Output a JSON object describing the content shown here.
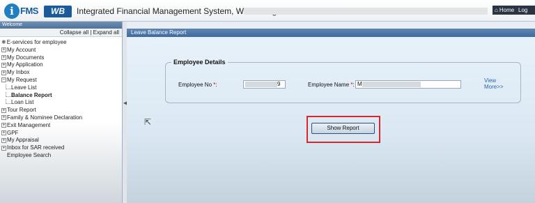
{
  "header": {
    "logo_letter": "i",
    "logo_text": "FMS",
    "logo_region": "WB",
    "app_title": "Integrated Financial Management System, West Bengal",
    "home_label": "Home",
    "logout_label": "Log"
  },
  "sidebar": {
    "welcome": "Welcome",
    "collapse_all": "Collapse all",
    "separator": "|",
    "expand_all": "Expand all",
    "root": "E-services for employee",
    "items": [
      {
        "label": "My Account",
        "type": "plus"
      },
      {
        "label": "My Documents",
        "type": "plus"
      },
      {
        "label": "My Application",
        "type": "plus"
      },
      {
        "label": "My Inbox",
        "type": "plus"
      },
      {
        "label": "My Request",
        "type": "minus"
      },
      {
        "label": "Leave List",
        "type": "child"
      },
      {
        "label": "Balance Report",
        "type": "child",
        "bold": true
      },
      {
        "label": "Loan List",
        "type": "child"
      },
      {
        "label": "Tour Report",
        "type": "plus"
      },
      {
        "label": "Family & Nominee Declaration",
        "type": "plus"
      },
      {
        "label": "Exit Management",
        "type": "plus"
      },
      {
        "label": "GPF",
        "type": "plus"
      },
      {
        "label": "My Appraisal",
        "type": "plus"
      },
      {
        "label": "Inbox for SAR received",
        "type": "plus"
      },
      {
        "label": "Employee Search",
        "type": "leaf"
      }
    ]
  },
  "main": {
    "panel_title": "Leave Balance Report",
    "fieldset_legend": "Employee Details",
    "employee_no_label": "Employee No",
    "employee_no_value_suffix": "9",
    "employee_name_label": "Employee Name",
    "employee_name_value_prefix": "M",
    "required_mark": "*",
    "view_more_line1": "View",
    "view_more_line2": "More>>",
    "show_report_label": "Show Report"
  },
  "colors": {
    "highlight_border": "#d9262c",
    "panel_header": "#4a73a5",
    "link": "#2d68a8"
  }
}
